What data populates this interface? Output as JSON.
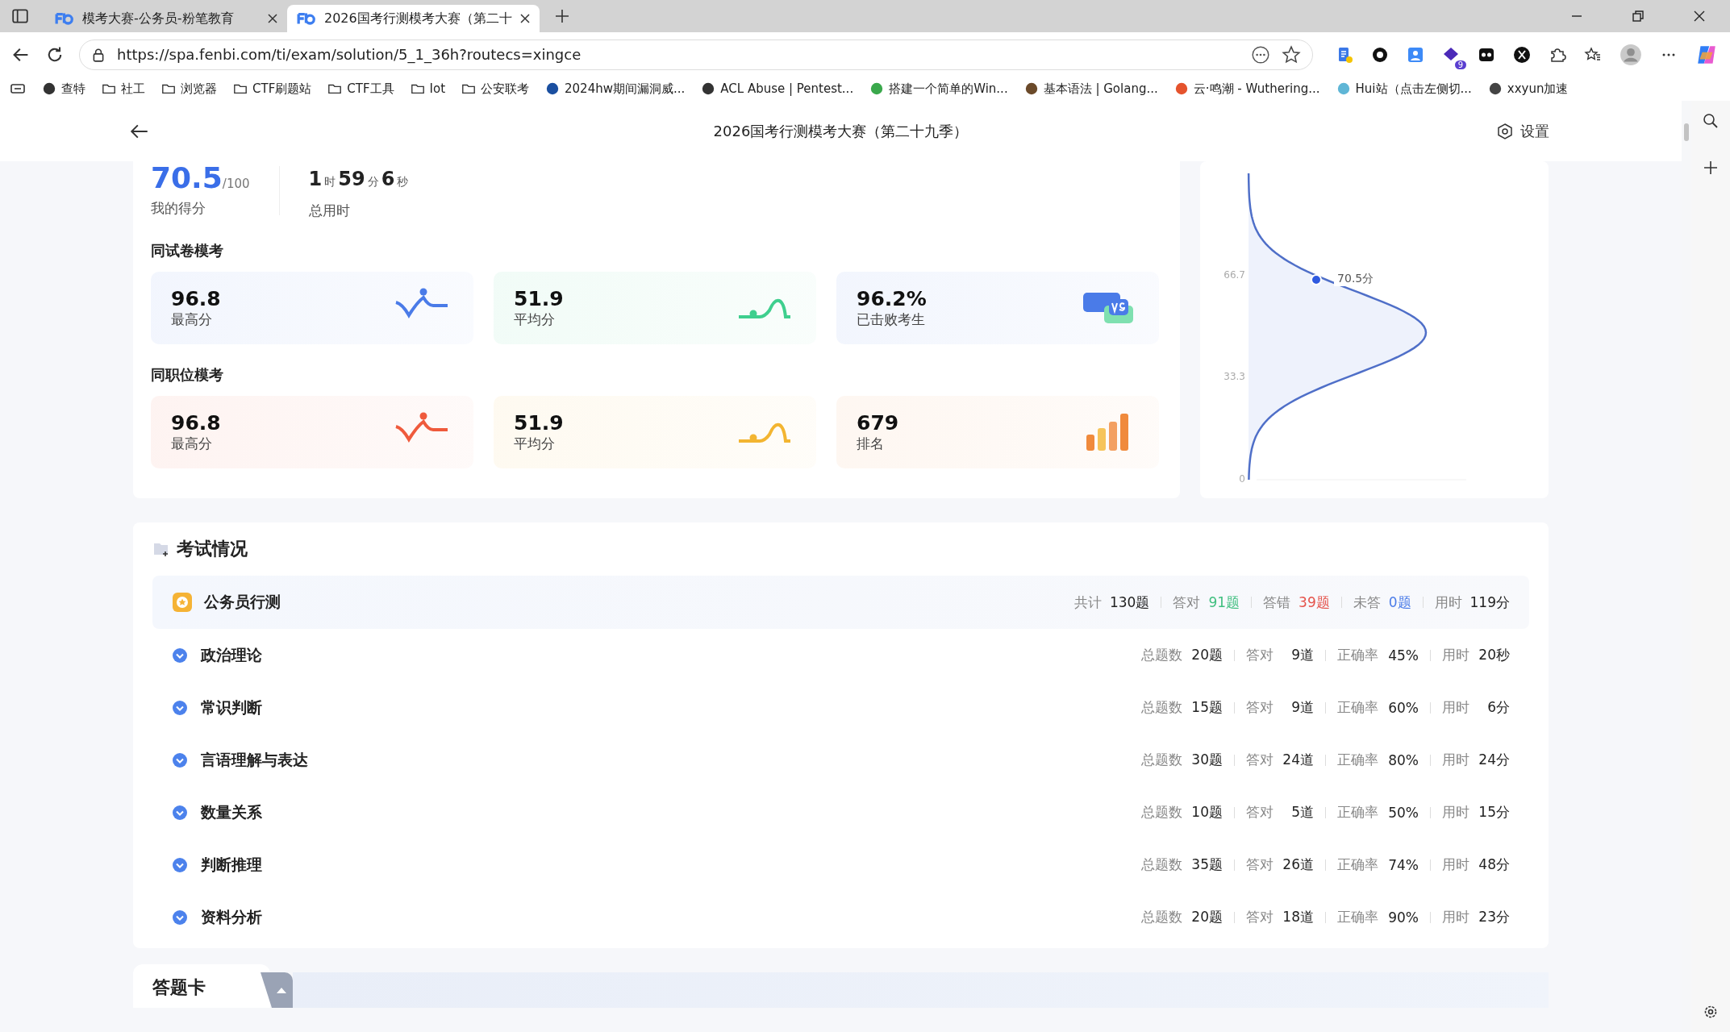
{
  "browser": {
    "tabs": [
      {
        "title": "模考大赛-公务员-粉笔教育",
        "selected": false
      },
      {
        "title": "2026国考行测模考大赛（第二十",
        "selected": true
      }
    ],
    "url": "https://spa.fenbi.com/ti/exam/solution/5_1_36h?routecs=xingce",
    "bookmarks": [
      {
        "label": "查特",
        "kind": "site"
      },
      {
        "label": "社工",
        "kind": "folder"
      },
      {
        "label": "浏览器",
        "kind": "folder"
      },
      {
        "label": "CTF刷题站",
        "kind": "folder"
      },
      {
        "label": "CTF工具",
        "kind": "folder"
      },
      {
        "label": "Iot",
        "kind": "folder"
      },
      {
        "label": "公安联考",
        "kind": "folder"
      },
      {
        "label": "2024hw期间漏洞威...",
        "kind": "site"
      },
      {
        "label": "ACL Abuse | Pentest...",
        "kind": "site"
      },
      {
        "label": "搭建一个简单的Win...",
        "kind": "site"
      },
      {
        "label": "基本语法 | Golang...",
        "kind": "site"
      },
      {
        "label": "云·鸣潮 - Wuthering...",
        "kind": "site"
      },
      {
        "label": "Hui站（点击左侧切...",
        "kind": "site"
      },
      {
        "label": "xxyun加速",
        "kind": "site"
      }
    ],
    "extension_badge": "9"
  },
  "header": {
    "title": "2026国考行测模考大赛（第二十九季）",
    "settings": "设置"
  },
  "score": {
    "value": "70.5",
    "total": "/100",
    "label": "我的得分"
  },
  "time": {
    "parts": [
      {
        "num": "1",
        "unit": "时"
      },
      {
        "num": "59",
        "unit": "分"
      },
      {
        "num": "6",
        "unit": "秒"
      }
    ],
    "label": "总用时"
  },
  "groups": [
    {
      "title": "同试卷模考",
      "cards": [
        {
          "value": "96.8",
          "label": "最高分",
          "kind": "max",
          "color": "#4a7be8"
        },
        {
          "value": "51.9",
          "label": "平均分",
          "kind": "avg",
          "color": "#3fcf8e"
        },
        {
          "value": "96.2%",
          "label": "已击败考生",
          "kind": "vs",
          "color": "#4a7be8"
        }
      ]
    },
    {
      "title": "同职位模考",
      "cards": [
        {
          "value": "96.8",
          "label": "最高分",
          "kind": "max",
          "color": "#ef5a3c"
        },
        {
          "value": "51.9",
          "label": "平均分",
          "kind": "avg",
          "color": "#f3b531"
        },
        {
          "value": "679",
          "label": "排名",
          "kind": "rank",
          "color": "#f08a3c"
        }
      ]
    }
  ],
  "distribution": {
    "ticks": [
      "66.7",
      "33.3",
      "0"
    ],
    "marker_label": "70.5分"
  },
  "exam": {
    "title": "考试情况",
    "summary": {
      "name": "公务员行测",
      "stats": [
        {
          "label": "共计",
          "value": "130题",
          "color": "#222222"
        },
        {
          "label": "答对",
          "value": "91题",
          "color": "#3fbf7f"
        },
        {
          "label": "答错",
          "value": "39题",
          "color": "#e5534b"
        },
        {
          "label": "未答",
          "value": "0题",
          "color": "#4a7be8"
        },
        {
          "label": "用时",
          "value": "119分",
          "color": "#222222"
        }
      ]
    },
    "sections": [
      {
        "name": "政治理论",
        "stats": [
          {
            "label": "总题数",
            "value": "20题"
          },
          {
            "label": "答对",
            "value": "9道"
          },
          {
            "label": "正确率",
            "value": "45%"
          },
          {
            "label": "用时",
            "value": "20秒"
          }
        ]
      },
      {
        "name": "常识判断",
        "stats": [
          {
            "label": "总题数",
            "value": "15题"
          },
          {
            "label": "答对",
            "value": "9道"
          },
          {
            "label": "正确率",
            "value": "60%"
          },
          {
            "label": "用时",
            "value": "6分"
          }
        ]
      },
      {
        "name": "言语理解与表达",
        "stats": [
          {
            "label": "总题数",
            "value": "30题"
          },
          {
            "label": "答对",
            "value": "24道"
          },
          {
            "label": "正确率",
            "value": "80%"
          },
          {
            "label": "用时",
            "value": "24分"
          }
        ]
      },
      {
        "name": "数量关系",
        "stats": [
          {
            "label": "总题数",
            "value": "10题"
          },
          {
            "label": "答对",
            "value": "5道"
          },
          {
            "label": "正确率",
            "value": "50%"
          },
          {
            "label": "用时",
            "value": "15分"
          }
        ]
      },
      {
        "name": "判断推理",
        "stats": [
          {
            "label": "总题数",
            "value": "35题"
          },
          {
            "label": "答对",
            "value": "26道"
          },
          {
            "label": "正确率",
            "value": "74%"
          },
          {
            "label": "用时",
            "value": "48分"
          }
        ]
      },
      {
        "name": "资料分析",
        "stats": [
          {
            "label": "总题数",
            "value": "20题"
          },
          {
            "label": "答对",
            "value": "18道"
          },
          {
            "label": "正确率",
            "value": "90%"
          },
          {
            "label": "用时",
            "value": "23分"
          }
        ]
      }
    ]
  },
  "answer_card": {
    "title": "答题卡"
  }
}
